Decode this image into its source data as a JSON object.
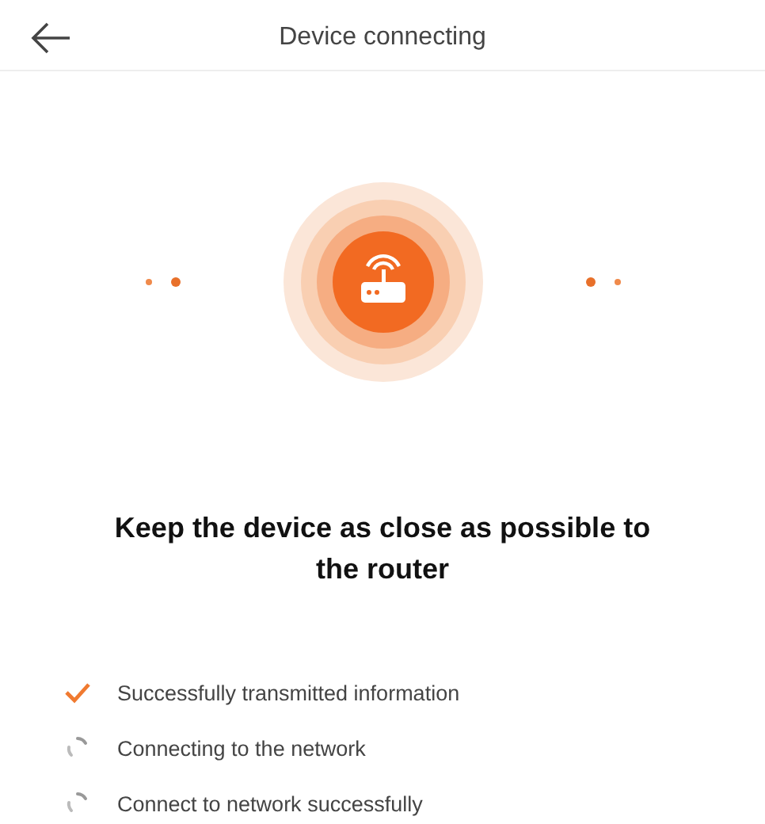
{
  "header": {
    "title": "Device connecting"
  },
  "message": "Keep the device as close as possible to the router",
  "steps": [
    {
      "label": "Successfully transmitted information",
      "done": true
    },
    {
      "label": "Connecting to the network",
      "done": false
    },
    {
      "label": "Connect to network successfully",
      "done": false
    }
  ]
}
